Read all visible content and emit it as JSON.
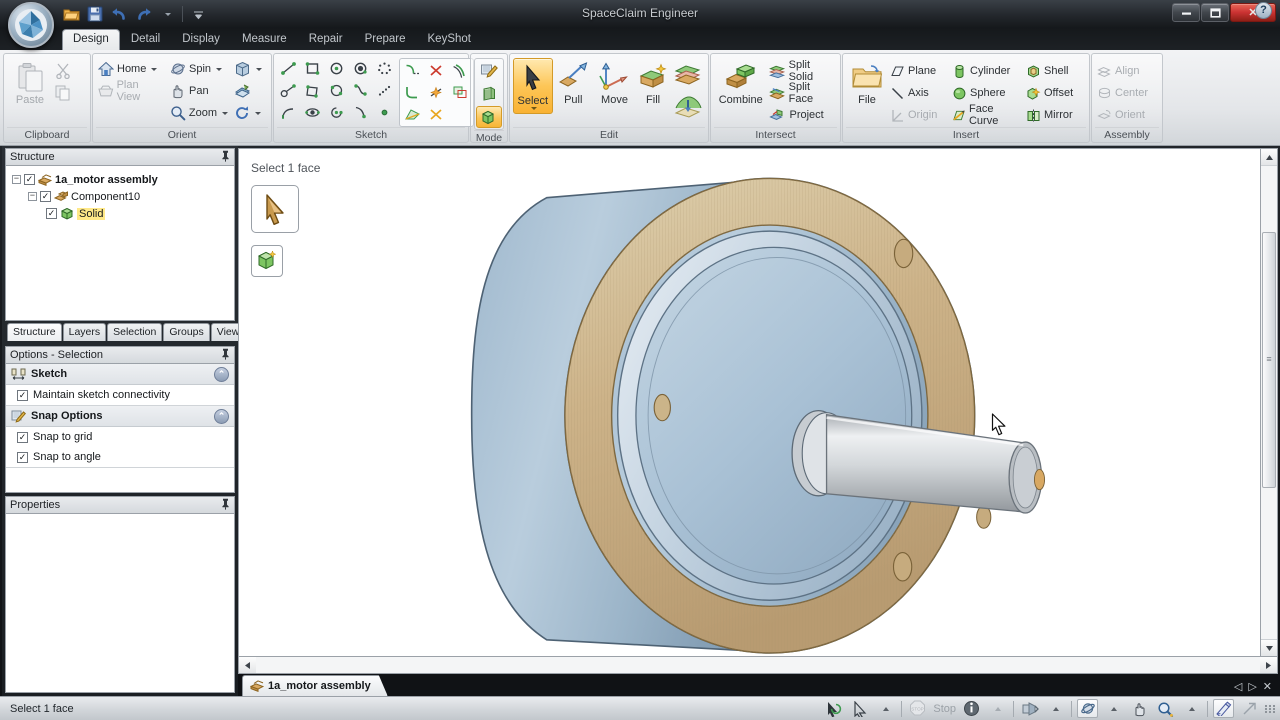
{
  "window": {
    "title": "SpaceClaim Engineer",
    "minimize_label": "—",
    "maximize_label": "❐",
    "close_label": "✕"
  },
  "quick_access": {
    "items": [
      {
        "name": "open-icon",
        "label": "Open"
      },
      {
        "name": "save-icon",
        "label": "Save"
      },
      {
        "name": "undo-icon",
        "label": "Undo"
      },
      {
        "name": "redo-icon",
        "label": "Redo"
      },
      {
        "name": "redo-dropdown-icon",
        "label": "Redo options"
      },
      {
        "name": "customize-qat-icon",
        "label": "Customize Quick Access Toolbar"
      }
    ]
  },
  "ribbon": {
    "tabs": [
      {
        "label": "Design",
        "active": true
      },
      {
        "label": "Detail",
        "active": false
      },
      {
        "label": "Display",
        "active": false
      },
      {
        "label": "Measure",
        "active": false
      },
      {
        "label": "Repair",
        "active": false
      },
      {
        "label": "Prepare",
        "active": false
      },
      {
        "label": "KeyShot",
        "active": false
      }
    ],
    "help_label": "?",
    "groups": {
      "clipboard": {
        "label": "Clipboard",
        "paste_label": "Paste",
        "cut_label": "Cut",
        "copy_label": "Copy"
      },
      "orient": {
        "label": "Orient",
        "home_label": "Home",
        "plan_view_label": "Plan View",
        "spin_label": "Spin",
        "pan_label": "Pan",
        "zoom_label": "Zoom",
        "view_cube_label": "View",
        "section_label": "Section",
        "rotate_label": "Rotate"
      },
      "sketch": {
        "label": "Sketch",
        "tools": [
          [
            "line-tool",
            "rectangle-tool",
            "circle-tool",
            "circle-center-tool",
            "polygon-tool"
          ],
          [
            "tangent-line-tool",
            "rect-corner-tool",
            "arc-tool",
            "spline-tool",
            "points-tool"
          ],
          [
            "curve-tool",
            "ellipse-tool",
            "arc-sweep-tool",
            "tangent-arc-tool",
            "point-tool"
          ]
        ],
        "modify_tools": [
          [
            "trim-away-tool",
            "trim-tool",
            "offset-curve-tool"
          ],
          [
            "corner-tool",
            "split-curve-tool",
            "project-to-sketch-tool"
          ],
          [
            "plane-edit-tool",
            "create-corner-tool"
          ]
        ]
      },
      "mode": {
        "label": "Mode",
        "buttons": [
          {
            "name": "sketch-mode",
            "active": false
          },
          {
            "name": "section-mode",
            "active": false
          },
          {
            "name": "solid-mode",
            "active": true
          }
        ]
      },
      "edit": {
        "label": "Edit",
        "select_label": "Select",
        "pull_label": "Pull",
        "move_label": "Move",
        "fill_label": "Fill",
        "blend_label": "Blend",
        "shell_edit_label": "Shell"
      },
      "intersect": {
        "label": "Intersect",
        "combine_label": "Combine",
        "split_solid_label": "Split Solid",
        "split_face_label": "Split Face",
        "project_label": "Project"
      },
      "insert": {
        "label": "Insert",
        "file_label": "File",
        "plane_label": "Plane",
        "axis_label": "Axis",
        "origin_label": "Origin",
        "cylinder_label": "Cylinder",
        "sphere_label": "Sphere",
        "face_curve_label": "Face Curve",
        "shell_label": "Shell",
        "offset_label": "Offset",
        "mirror_label": "Mirror"
      },
      "assembly": {
        "label": "Assembly",
        "align_label": "Align",
        "center_label": "Center",
        "orient_label": "Orient"
      }
    }
  },
  "structure_panel": {
    "title": "Structure",
    "pin_label": "Auto Hide",
    "tree": [
      {
        "label": "1a_motor assembly",
        "level": 1,
        "checked": true,
        "expanded": true,
        "bold": true,
        "selected": false,
        "icon": "assembly-icon"
      },
      {
        "label": "Component10",
        "level": 2,
        "checked": true,
        "expanded": true,
        "bold": false,
        "selected": false,
        "icon": "component-icon"
      },
      {
        "label": "Solid",
        "level": 3,
        "checked": true,
        "expanded": false,
        "bold": false,
        "selected": true,
        "icon": "solid-icon"
      }
    ],
    "tabs": [
      {
        "label": "Structure",
        "active": true
      },
      {
        "label": "Layers",
        "active": false
      },
      {
        "label": "Selection",
        "active": false
      },
      {
        "label": "Groups",
        "active": false
      },
      {
        "label": "Views",
        "active": false
      }
    ]
  },
  "options_panel": {
    "title": "Options - Selection",
    "pin_label": "Auto Hide",
    "sections": [
      {
        "title": "Sketch",
        "icon": "sketch-section-icon",
        "collapse_label": "⌃",
        "rows": [
          {
            "label": "Maintain sketch connectivity",
            "checked": true
          }
        ]
      },
      {
        "title": "Snap Options",
        "icon": "snap-section-icon",
        "collapse_label": "⌃",
        "rows": [
          {
            "label": "Snap to grid",
            "checked": true
          },
          {
            "label": "Snap to angle",
            "checked": true
          }
        ]
      }
    ]
  },
  "properties_panel": {
    "title": "Properties",
    "pin_label": "Auto Hide"
  },
  "viewport": {
    "status_text": "Select 1 face",
    "tools": [
      {
        "name": "select-tool-button",
        "label": "Select"
      },
      {
        "name": "solid-tool-button",
        "label": "Solid"
      }
    ],
    "model": {
      "name": "motor-flywheel-assembly",
      "colors": {
        "highlighted_face": "#cdb389",
        "body": "#aec3d6",
        "body_dark": "#8ea8bf",
        "shaft": "#c9cdd1",
        "edge": "#5a6874"
      }
    },
    "scroll": {
      "vertical_thumb_top_pct": 14,
      "vertical_thumb_height_pct": 54,
      "up_arrow": "▲",
      "down_arrow": "▼",
      "left_arrow": "◄",
      "right_arrow": "►"
    }
  },
  "document_tabs": [
    {
      "label": "1a_motor assembly",
      "active": true,
      "icon": "assembly-icon"
    }
  ],
  "doc_nav": {
    "prev_label": "◁",
    "next_label": "▷",
    "close_label": "✕"
  },
  "statusbar": {
    "message": "Select 1 face",
    "stop_label": "Stop",
    "items": [
      {
        "name": "select-back-icon",
        "enabled": true
      },
      {
        "name": "select-arrow-icon",
        "enabled": true
      },
      {
        "name": "select-dropdown-icon",
        "enabled": true
      },
      {
        "name": "stop-icon",
        "enabled": false
      },
      {
        "name": "info-icon",
        "enabled": true
      },
      {
        "name": "info-dropdown-icon",
        "enabled": true
      },
      {
        "name": "view-mode-icon",
        "enabled": true
      },
      {
        "name": "view-dropdown-icon",
        "enabled": true
      },
      {
        "name": "spin-icon",
        "enabled": true
      },
      {
        "name": "spin-dropdown-icon",
        "enabled": true
      },
      {
        "name": "pan-icon",
        "enabled": true
      },
      {
        "name": "zoom-icon",
        "enabled": true
      },
      {
        "name": "zoom-dropdown-icon",
        "enabled": true
      },
      {
        "name": "sketch-status-icon",
        "enabled": true
      },
      {
        "name": "fullscreen-icon",
        "enabled": true
      },
      {
        "name": "resize-grip-icon",
        "enabled": false
      }
    ]
  }
}
